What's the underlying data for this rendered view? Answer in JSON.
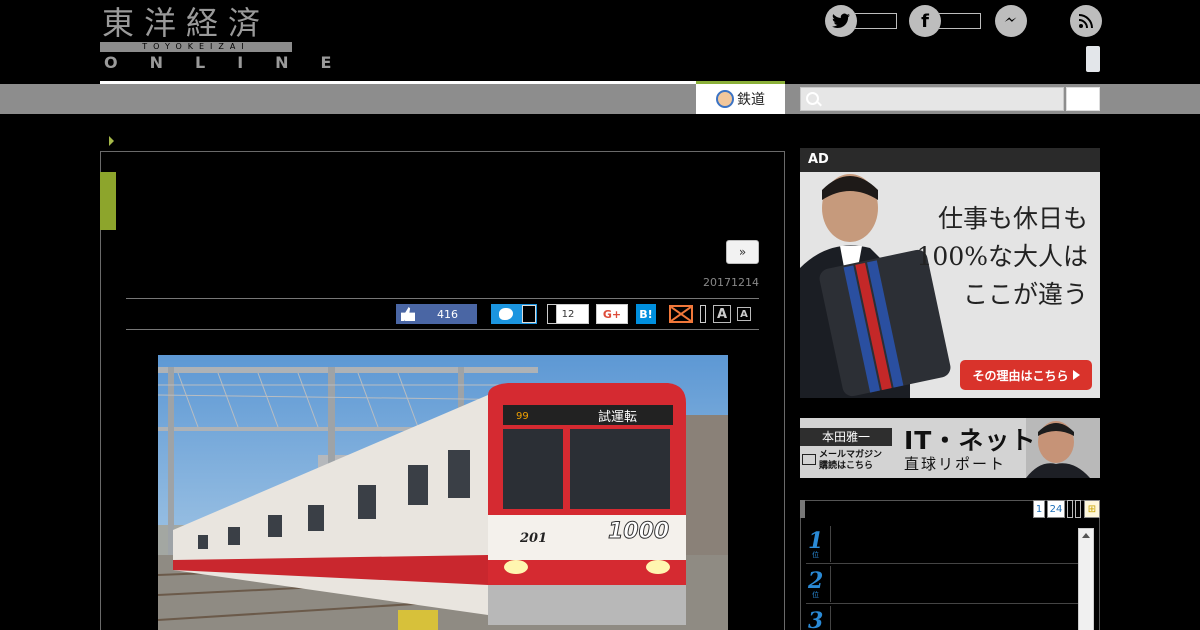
{
  "header": {
    "logo_jp": "東洋経済",
    "logo_roman": "TOYOKEIZAI",
    "logo_online": "ONLINE"
  },
  "nav": {
    "active_tab": "鉄道",
    "search_placeholder": ""
  },
  "article": {
    "next_label": "»",
    "date": "20171214",
    "share": {
      "like_count": "416",
      "hatena_count": "12",
      "gplus_label": "G+",
      "hatena_label": "B!",
      "font_large": "A",
      "font_small": "A"
    },
    "photo": {
      "headboard": "試運転",
      "run_number": "99",
      "car_number": "201",
      "series_logo": "1000"
    }
  },
  "sidebar": {
    "ad1": {
      "label": "AD",
      "copy_lines": [
        "仕事も休日も",
        "100%な大人は",
        "ここが違う"
      ],
      "cta": "その理由はこちら"
    },
    "ad2": {
      "author": "本田雅一",
      "title": "IT・ネット",
      "subtitle": "直球リポート",
      "mail_text_1": "メールマガジン",
      "mail_text_2": "購読はこちら"
    },
    "ranking": {
      "tabs": [
        "1",
        "24"
      ],
      "last_tab": "⊞",
      "items": [
        {
          "num": "1",
          "unit": "位"
        },
        {
          "num": "2",
          "unit": "位"
        },
        {
          "num": "3",
          "unit": "位"
        }
      ]
    }
  },
  "colors": {
    "accent_green": "#8da52c",
    "nav_gray": "#8d8d8d",
    "facebook_blue": "#4a66a4",
    "twitter_blue": "#1b95e0",
    "mail_orange": "#f1783a",
    "cta_red": "#d9332b",
    "rank_blue": "#2a8ad6"
  }
}
